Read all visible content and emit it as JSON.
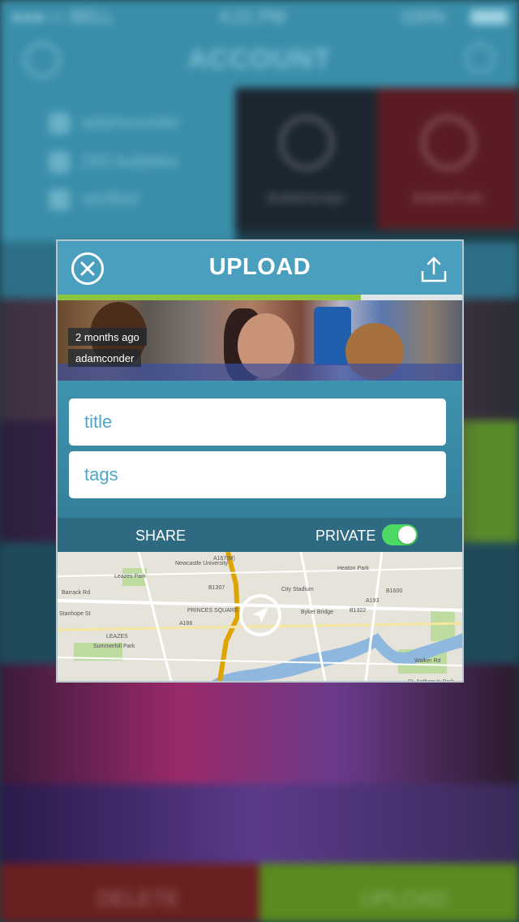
{
  "background": {
    "status_bar": {
      "carrier": "●●●○○ BELL",
      "time": "4:21 PM",
      "battery": "100%"
    },
    "header_title": "ACCOUNT",
    "profile": {
      "username": "adamconder",
      "bubbles": "293 bubbles",
      "verified": "verified"
    },
    "tiles": [
      {
        "label": "BubbleScope",
        "icon": "check-icon",
        "color": "#1c2630"
      },
      {
        "label": "BubblePods",
        "icon": "x-icon",
        "color": "#5a1c22"
      }
    ],
    "bottom_bar": {
      "delete_label": "DELETE",
      "upload_label": "UPLOAD"
    }
  },
  "modal": {
    "title": "UPLOAD",
    "close_icon": "close-circle-icon",
    "upload_icon": "share-upload-icon",
    "progress": 0.75,
    "progress_color": "#8cc63f",
    "video": {
      "age": "2 months ago",
      "author": "adamconder"
    },
    "title_field": {
      "value": "",
      "placeholder": "title"
    },
    "tags_field": {
      "value": "",
      "placeholder": "tags"
    },
    "share_label": "SHARE",
    "private_label": "PRIVATE",
    "private_enabled": true,
    "map": {
      "labels": [
        "Heaton Park",
        "Newcastle University",
        "Leazes Park",
        "City Stadium",
        "Barrack Rd",
        "Stanhope St",
        "PRINCES SQUARE",
        "LEAZES",
        "Byker Bridge",
        "Summerhill Park",
        "St. Anthony's Park",
        "A167(M)",
        "A186",
        "A193",
        "B1307",
        "B1600",
        "B1322",
        "Walker Rd"
      ],
      "locate_icon": "compass-locate-icon"
    }
  }
}
